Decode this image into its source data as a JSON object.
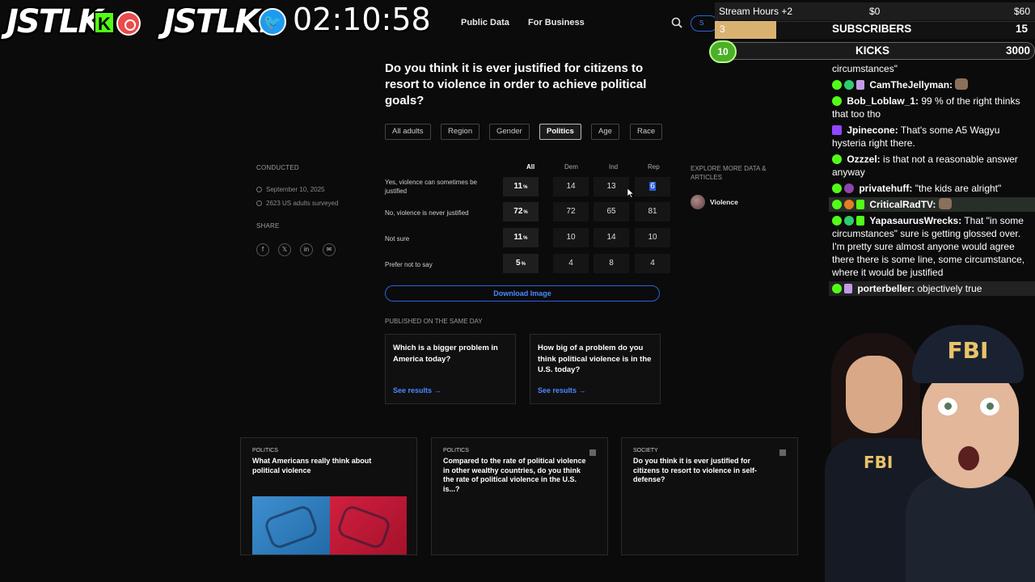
{
  "overlay": {
    "logo1": "JSTLK",
    "logo2": "JSTLK.",
    "kick_badge": "K",
    "twitter_badge": "🐦",
    "timer": "02:10:58"
  },
  "nav": {
    "public_data": "Public Data",
    "for_business": "For Business",
    "signin": "S"
  },
  "question": "Do you think it is ever justified for citizens to resort to violence in order to achieve political goals?",
  "filters": [
    "All adults",
    "Region",
    "Gender",
    "Politics",
    "Age",
    "Race"
  ],
  "active_filter": "Politics",
  "meta": {
    "conducted_label": "CONDUCTED",
    "date": "September 10, 2025",
    "surveyed": "2623 US adults surveyed",
    "share_label": "SHARE",
    "share_icons": [
      "f",
      "𝕏",
      "in",
      "✉"
    ]
  },
  "table": {
    "columns": [
      "All",
      "Dem",
      "Ind",
      "Rep"
    ],
    "pct_sign": "%",
    "rows": [
      {
        "label": "Yes, violence can sometimes be justified",
        "all": "11",
        "dem": "14",
        "ind": "13",
        "rep": "6"
      },
      {
        "label": "No, violence is never justified",
        "all": "72",
        "dem": "72",
        "ind": "65",
        "rep": "81"
      },
      {
        "label": "Not sure",
        "all": "11",
        "dem": "10",
        "ind": "14",
        "rep": "10"
      },
      {
        "label": "Prefer not to say",
        "all": "5",
        "dem": "4",
        "ind": "8",
        "rep": "4"
      }
    ]
  },
  "download_label": "Download Image",
  "explore": {
    "label": "EXPLORE MORE DATA & ARTICLES",
    "tag": "Violence"
  },
  "sameday": {
    "label": "PUBLISHED ON THE SAME DAY",
    "link_label": "See results →",
    "cards": [
      {
        "title": "Which is a bigger problem in America today?"
      },
      {
        "title": "How big of a problem do you think political violence is in the U.S. today?"
      }
    ]
  },
  "articles": [
    {
      "category": "POLITICS",
      "title": "What Americans really think about political violence"
    },
    {
      "category": "POLITICS",
      "title": "Compared to the rate of political violence in other wealthy countries, do you think the rate of political violence in the U.S. is...?"
    },
    {
      "category": "SOCIETY",
      "title": "Do you think it is ever justified for citizens to resort to violence in self-defense?"
    }
  ],
  "stream": {
    "hours_label": "Stream Hours +2",
    "hours_min": "$0",
    "hours_max": "$60",
    "subs_count": "3",
    "subs_label": "SUBSCRIBERS",
    "subs_goal": "15",
    "kicks_count": "10",
    "kicks_label": "KICKS",
    "kicks_goal": "3000"
  },
  "chat": [
    {
      "user": "",
      "text": "circumstances\""
    },
    {
      "user": "CamTheJellyman:",
      "text": ""
    },
    {
      "user": "Bob_Loblaw_1:",
      "text": "99 % of the right thinks that too tho"
    },
    {
      "user": "Jpinecone:",
      "text": "That's some A5 Wagyu hysteria right there."
    },
    {
      "user": "Ozzzel:",
      "text": "is that not a reasonable answer anyway"
    },
    {
      "user": "privatehuff:",
      "text": "\"the kids are alright\""
    },
    {
      "user": "CriticalRadTV:",
      "text": ""
    },
    {
      "user": "YapasaurusWrecks:",
      "text": "That \"in some circumstances\" sure is getting glossed over. I'm pretty sure almost anyone would agree there there is some line, some circumstance, where it would be justified"
    },
    {
      "user": "porterbeller:",
      "text": "objectively true"
    }
  ],
  "avatar": {
    "cap_text": "FBI",
    "badge_text": "FBI"
  },
  "colors": {
    "accent": "#4d88ff",
    "kick_green": "#53fc18",
    "selection": "#2b5fd9"
  }
}
